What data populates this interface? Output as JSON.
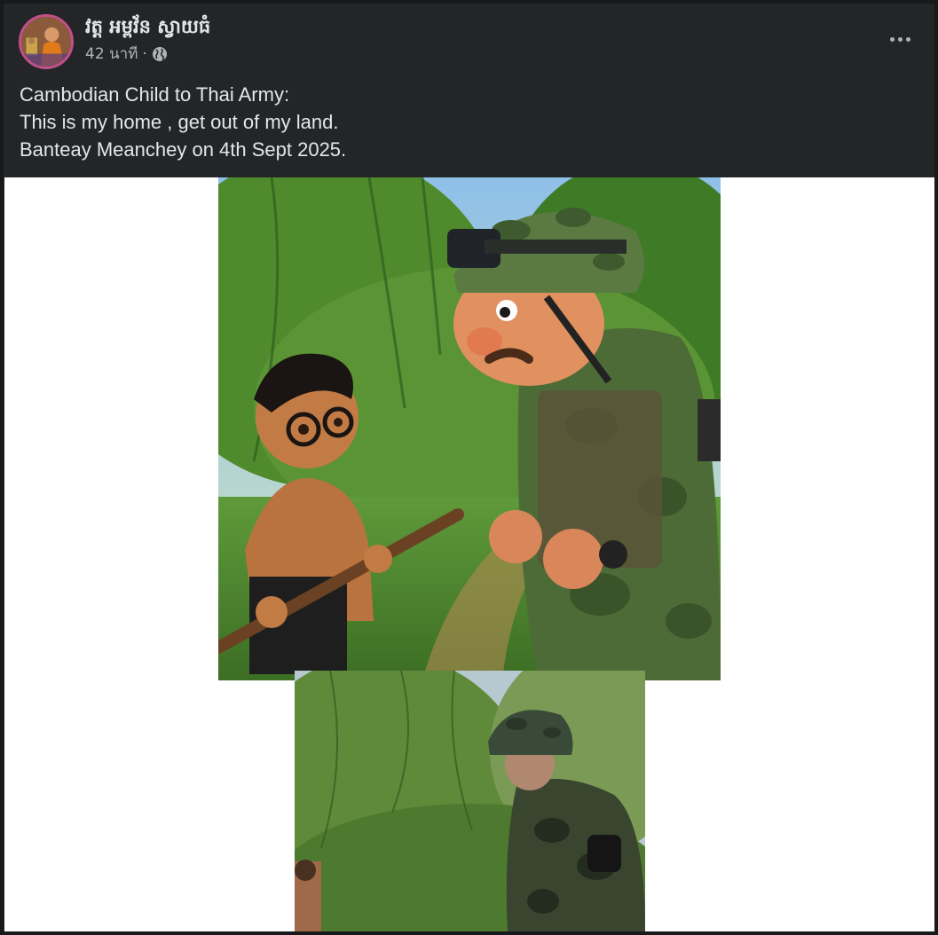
{
  "post": {
    "author_name": "វត្ត អម្ពវ័ន ស្វាយធំ",
    "timestamp": "42 นาที",
    "separator": "·",
    "privacy_icon": "globe-icon",
    "more_icon": "more-horizontal-icon",
    "caption_lines": [
      "Cambodian Child to Thai Army:",
      "This is my home , get out of my land.",
      "Banteay Meanchey on 4th Sept 2025."
    ]
  },
  "media": {
    "images": [
      {
        "icon": "illustration-image"
      },
      {
        "icon": "photo-image"
      }
    ]
  },
  "colors": {
    "background": "#18191a",
    "card": "#242526",
    "text_primary": "#e4e6eb",
    "text_secondary": "#b0b3b8",
    "media_background": "#ffffff"
  }
}
